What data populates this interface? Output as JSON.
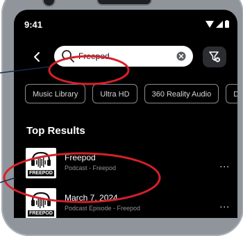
{
  "status": {
    "time": "9:41"
  },
  "search": {
    "value": "Freepod"
  },
  "chips": [
    "Music Library",
    "Ultra HD",
    "360 Reality Audio",
    "Dolby"
  ],
  "section": {
    "title": "Top Results"
  },
  "results": [
    {
      "title": "Freepod",
      "subtitle": "Podcast - Freepod",
      "thumb_label": "FREEPOD",
      "more": "..."
    },
    {
      "title": "March 7, 2024",
      "subtitle": "Podcast Episode - Freepod",
      "thumb_label": "FREEPOD",
      "more": "..."
    }
  ],
  "colors": {
    "highlight": "#d6202a",
    "frame": "#8f959b",
    "screen": "#000000"
  },
  "icons": [
    "back-arrow-icon",
    "search-icon",
    "clear-icon",
    "filter-icon",
    "wifi-icon",
    "signal-icon",
    "battery-icon",
    "more-icon",
    "podcast-waveform-icon"
  ]
}
